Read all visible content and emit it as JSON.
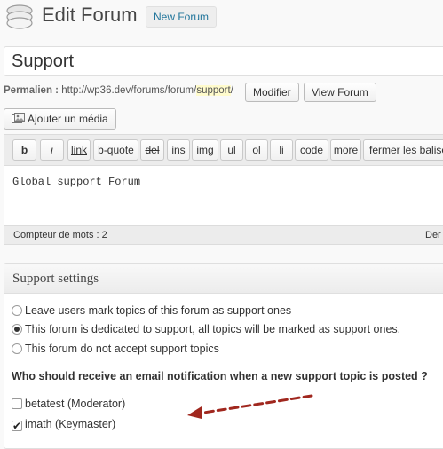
{
  "header": {
    "title": "Edit Forum",
    "add_new": "New Forum"
  },
  "title_field": {
    "value": "Support"
  },
  "permalink": {
    "label": "Permalien :",
    "url_prefix": "http://wp36.dev/forums/forum/",
    "slug": "support",
    "url_suffix": "/",
    "edit_button": "Modifier",
    "view_button": "View Forum"
  },
  "media_button": {
    "label": "Ajouter un média"
  },
  "editor": {
    "toolbar": [
      "b",
      "i",
      "link",
      "b-quote",
      "del",
      "ins",
      "img",
      "ul",
      "ol",
      "li",
      "code",
      "more",
      "fermer les balises"
    ],
    "content": "Global support Forum",
    "word_count": "Compteur de mots : 2",
    "draft_note": "Der"
  },
  "support_settings": {
    "title": "Support settings",
    "options": [
      {
        "label": "Leave users mark topics of this forum as support ones",
        "selected": false
      },
      {
        "label": "This forum is dedicated to support, all topics will be marked as support ones.",
        "selected": true
      },
      {
        "label": "This forum do not accept support topics",
        "selected": false
      }
    ],
    "question": "Who should receive an email notification when a new support topic is posted ?",
    "recipients": [
      {
        "label": "betatest (Moderator)",
        "checked": false
      },
      {
        "label": "imath (Keymaster)",
        "checked": true
      }
    ]
  },
  "colors": {
    "link": "#21759b",
    "arrow": "#a0271e",
    "slug_highlight": "#fffbcc"
  }
}
